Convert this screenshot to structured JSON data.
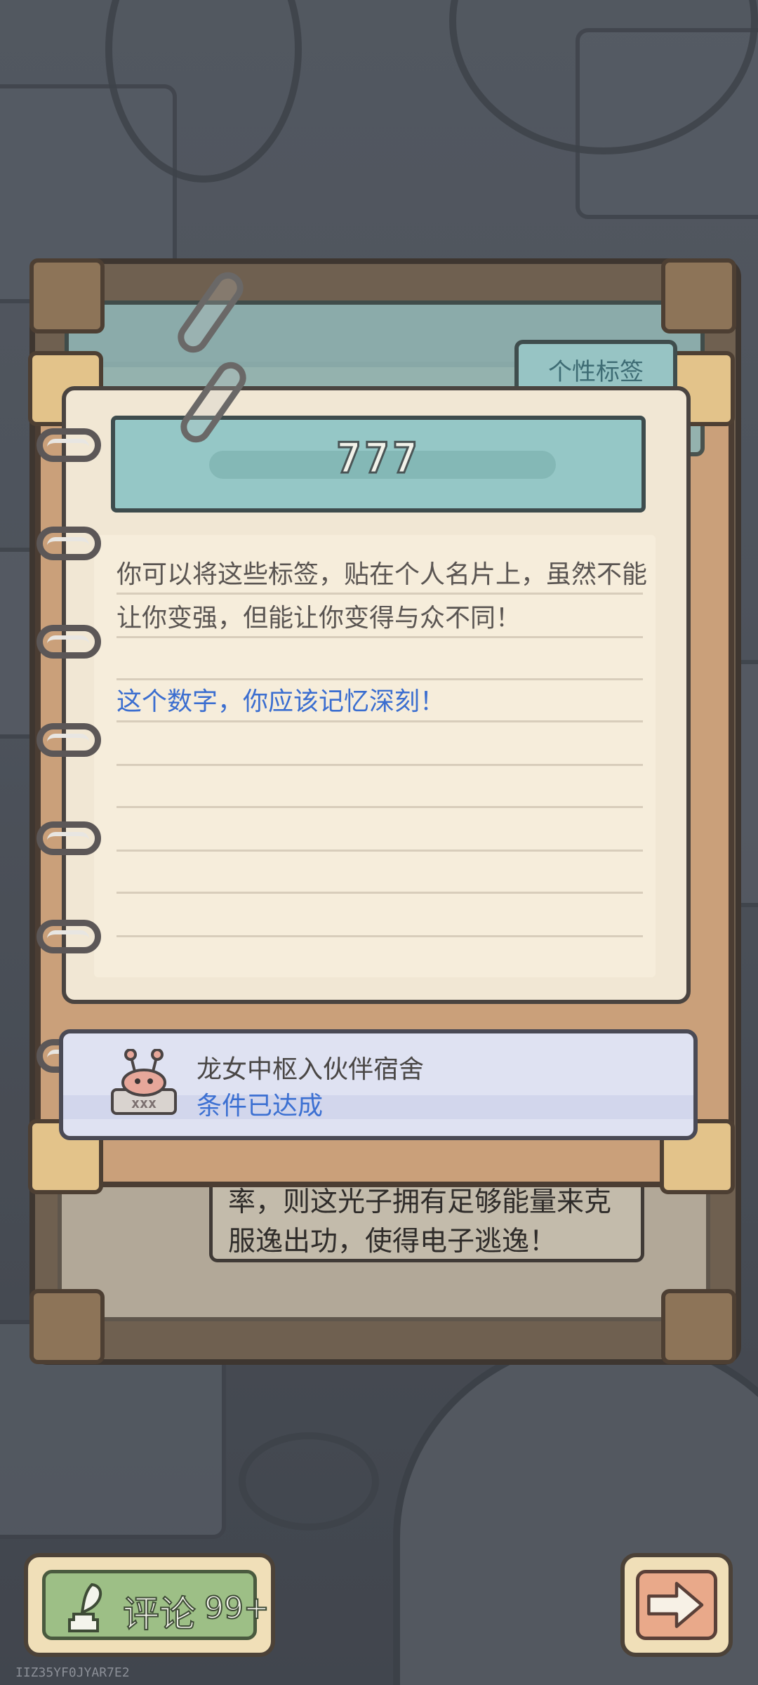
{
  "card": {
    "tab_label": "个性标签",
    "title": "777",
    "description": "你可以将这些标签，贴在个人名片上，虽然不能让你变强，但能让你变得与众不同！",
    "hint": "这个数字，你应该记忆深刻！"
  },
  "condition": {
    "name": "龙女中枢入伙伴宿舍",
    "status": "条件已达成",
    "icon": "snail-icon"
  },
  "background_page": {
    "text": "率，则这光子拥有足够能量来克服逸出功，使得电子逃逸！"
  },
  "comment": {
    "label": "评论",
    "count": "99+",
    "icon": "quill-icon"
  },
  "next": {
    "icon": "arrow-right-icon"
  },
  "footer": {
    "uid": "IIZ35YF0JYAR7E2"
  },
  "colors": {
    "hint_blue": "#3b6ed0",
    "tab_teal": "#97c4c4",
    "comment_green": "#9dbf86",
    "next_salmon": "#e9a98a"
  }
}
